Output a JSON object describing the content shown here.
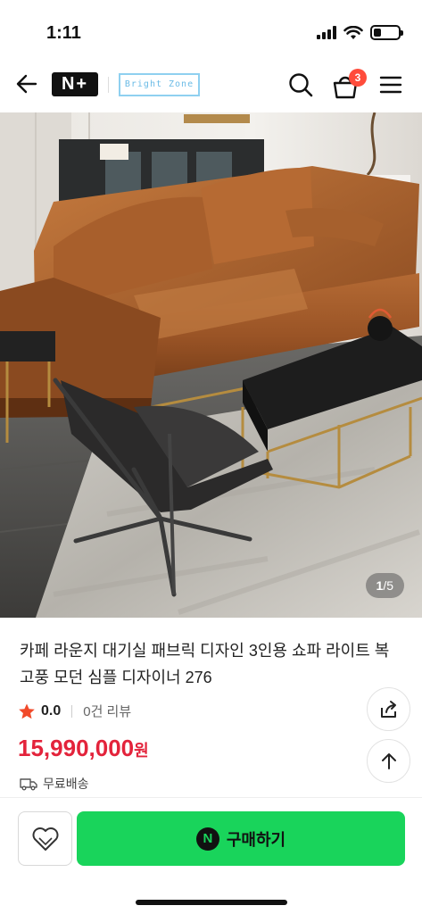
{
  "status": {
    "time": "1:11"
  },
  "header": {
    "logo_text": "N+",
    "store_name": "Bright Zone",
    "cart_count": "3"
  },
  "image": {
    "current": "1",
    "total": "/5"
  },
  "product": {
    "title": "카페 라운지 대기실 패브릭 디자인 3인용 쇼파 라이트 복고풍 모던 심플 디자이너 276",
    "rating": "0.0",
    "review_count": "0건 리뷰",
    "price": "15,990,000",
    "price_unit": "원",
    "shipping": "무료배송"
  },
  "actions": {
    "buy_badge": "N",
    "buy_label": "구매하기"
  },
  "colors": {
    "accent_green": "#19d45b",
    "price_red": "#e3233b",
    "badge_red": "#ff4c3b",
    "star": "#f14a2a"
  },
  "icons": [
    "back-arrow-icon",
    "search-icon",
    "cart-icon",
    "menu-icon",
    "star-icon",
    "truck-icon",
    "share-icon",
    "arrow-up-icon",
    "heart-icon"
  ]
}
